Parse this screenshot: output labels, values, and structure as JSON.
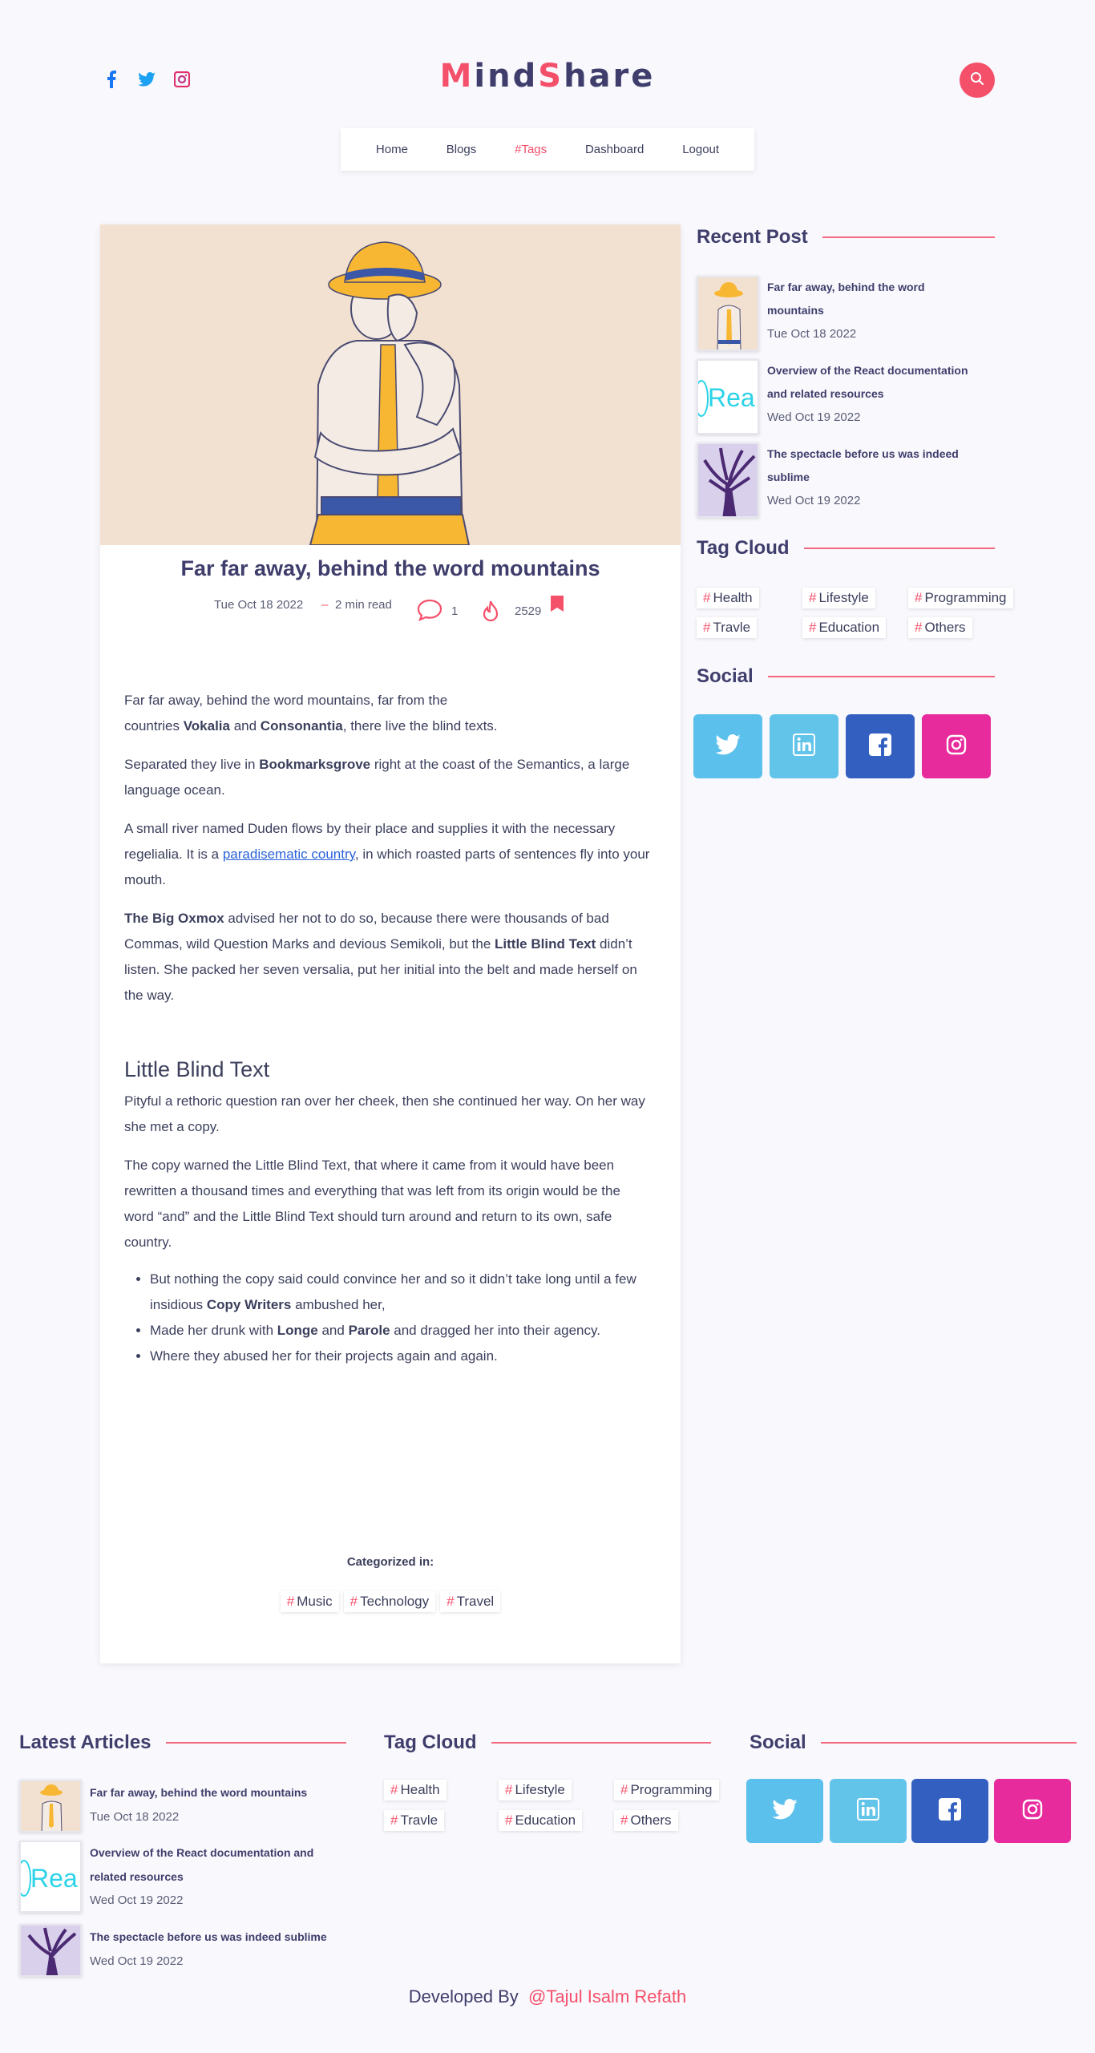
{
  "header": {
    "logo": {
      "l1": "M",
      "l2": "ind",
      "l3": "S",
      "l4": "hare"
    },
    "nav": [
      {
        "label": "Home"
      },
      {
        "label": "Blogs"
      },
      {
        "label": "#Tags"
      },
      {
        "label": "Dashboard"
      },
      {
        "label": "Logout"
      }
    ]
  },
  "post": {
    "title": "Far far away, behind the word mountains",
    "date": "Tue Oct 18 2022",
    "dash": "–",
    "read_time": "2 min read",
    "comments": "1",
    "views": "2529",
    "body": {
      "p1a": "Far far away, behind the word mountains, far from the",
      "p1b": "countries ",
      "p1c": "Vokalia",
      "p1d": " and ",
      "p1e": "Consonantia",
      "p1f": ", there live the blind texts.",
      "p2a": "Separated they live in ",
      "p2b": "Bookmarksgrove",
      "p2c": " right at the coast of the Semantics, a large language ocean.",
      "p3a": "A small river named Duden flows by their place and supplies it with the necessary regelialia. It is a ",
      "p3link": "paradisematic country",
      "p3b": ", in which roasted parts of sentences fly into your mouth.",
      "p4a": "The Big Oxmox",
      "p4b": " advised her not to do so, because there were thousands of bad Commas, wild Question Marks and devious Semikoli, but the ",
      "p4c": "Little Blind Text",
      "p4d": " didn’t listen. She packed her seven versalia, put her initial into the belt and made herself on the way.",
      "h2": "Little Blind Text",
      "p5": "Pityful a rethoric question ran over her cheek, then she continued her way. On her way she met a copy.",
      "p6": "The copy warned the Little Blind Text, that where it came from it would have been rewritten a thousand times and everything that was left from its origin would be the word “and” and the Little Blind Text should turn around and return to its own, safe country.",
      "li1a": "But nothing the copy said could convince her and so it didn’t take long until a few insidious ",
      "li1b": "Copy Writers",
      "li1c": " ambushed her,",
      "li2a": "Made her drunk with ",
      "li2b": "Longe",
      "li2c": " and ",
      "li2d": "Parole",
      "li2e": " and dragged her into their agency.",
      "li3": "Where they abused her for their projects again and again."
    },
    "categorized_label": "Categorized in:",
    "categories": [
      "Music",
      "Technology",
      "Travel"
    ]
  },
  "sidebar": {
    "recent_title": "Recent Post",
    "recent": [
      {
        "title_l1": "Far far away, behind the word",
        "title_l2": "mountains",
        "date": "Tue Oct 18 2022"
      },
      {
        "title_l1": "Overview of the React documentation",
        "title_l2": "and related resources",
        "date": "Wed Oct 19 2022"
      },
      {
        "title_l1": "The spectacle before us was indeed",
        "title_l2": "sublime",
        "date": "Wed Oct 19 2022"
      }
    ],
    "tag_title": "Tag Cloud",
    "tags": [
      "Health",
      "Lifestyle",
      "Programming",
      "Travle",
      "Education",
      "Others"
    ],
    "social_title": "Social"
  },
  "footer": {
    "latest_title": "Latest Articles",
    "latest": [
      {
        "title_l1": "Far far away, behind the word mountains",
        "title_l2": "",
        "date": "Tue Oct 18 2022"
      },
      {
        "title_l1": "Overview of the React documentation and",
        "title_l2": "related resources",
        "date": "Wed Oct 19 2022"
      },
      {
        "title_l1": "The spectacle before us was indeed sublime",
        "title_l2": "",
        "date": "Wed Oct 19 2022"
      }
    ],
    "tag_title": "Tag Cloud",
    "tags": [
      "Health",
      "Lifestyle",
      "Programming",
      "Travle",
      "Education",
      "Others"
    ],
    "social_title": "Social",
    "credit_prefix": "Developed By",
    "credit_name": "@Tajul Isalm Refath"
  },
  "thumb_text": {
    "react": "Rea"
  },
  "colors": {
    "accent": "#f5506a",
    "twitter": "#5bc0eb",
    "linkedin": "#63c4ea",
    "facebook": "#3360c0",
    "instagram": "#e82b9c"
  },
  "icons": [
    "facebook-icon",
    "twitter-icon",
    "instagram-icon",
    "search-icon",
    "comment-icon",
    "fire-icon",
    "bookmark-icon"
  ]
}
